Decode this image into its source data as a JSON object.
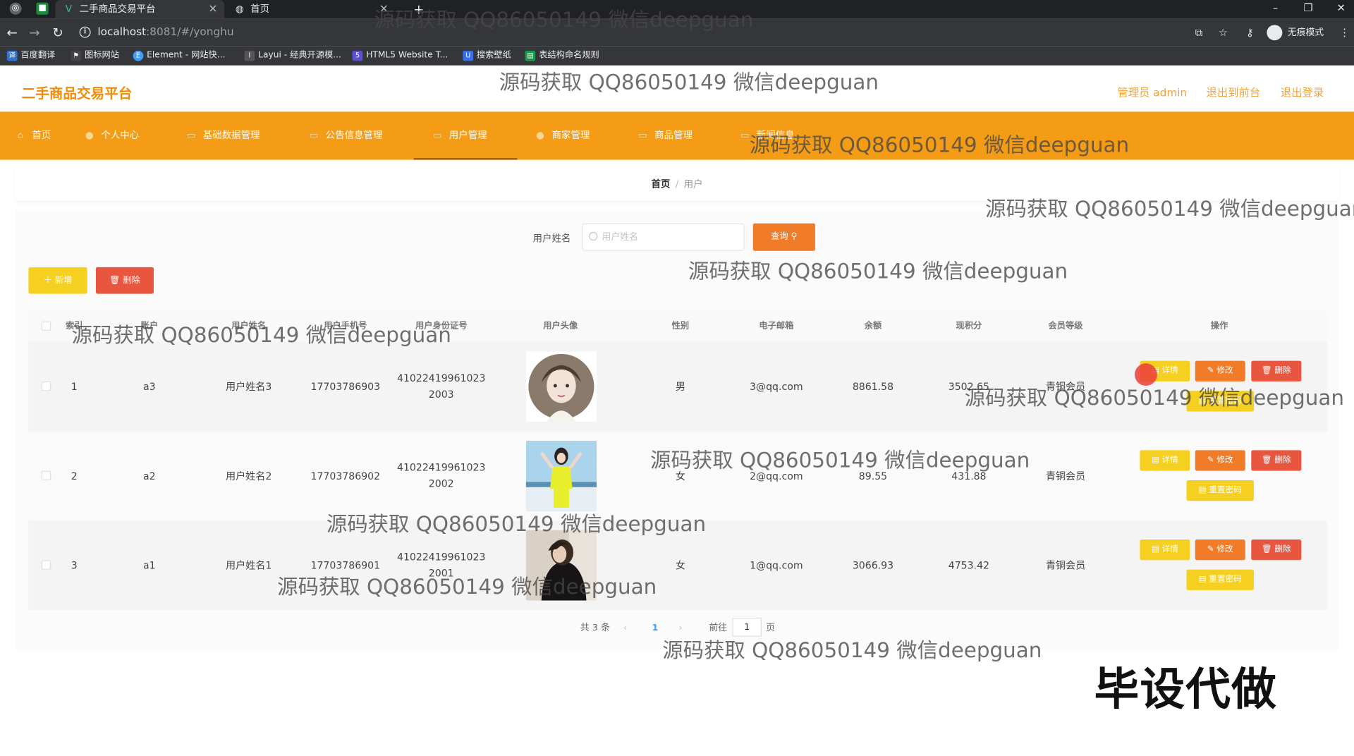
{
  "browser": {
    "tabs": [
      {
        "label": "二手商品交易平台"
      },
      {
        "label": "首页"
      }
    ],
    "url_host": "localhost",
    "url_rest": ":8081/#/yonghu",
    "profile_label": "无痕模式",
    "bookmarks": [
      "百度翻译",
      "图标网站",
      "Element - 网站快...",
      "Layui - 经典开源模...",
      "HTML5 Website T...",
      "搜索壁纸",
      "表结构命名规则"
    ]
  },
  "header": {
    "title": "二手商品交易平台",
    "admin_label": "管理员 admin",
    "frontend_link": "退出到前台",
    "logout_link": "退出登录"
  },
  "nav": {
    "items": [
      {
        "label": "首页"
      },
      {
        "label": "个人中心"
      },
      {
        "label": "基础数据管理"
      },
      {
        "label": "公告信息管理"
      },
      {
        "label": "用户管理"
      },
      {
        "label": "商家管理"
      },
      {
        "label": "商品管理"
      },
      {
        "label": "新闻信息"
      }
    ],
    "active_index": 4
  },
  "breadcrumb": {
    "home": "首页",
    "current": "用户"
  },
  "search": {
    "label": "用户姓名",
    "placeholder": "用户姓名",
    "button": "查询"
  },
  "actions": {
    "add": "＋ 新增",
    "delete": "删除"
  },
  "table": {
    "columns": [
      "索引",
      "账户",
      "用户姓名",
      "用户手机号",
      "用户身份证号",
      "用户头像",
      "性别",
      "电子邮箱",
      "余额",
      "现积分",
      "会员等级",
      "操作"
    ],
    "rows": [
      {
        "index": "1",
        "account": "a3",
        "name": "用户姓名3",
        "phone": "17703786903",
        "id_line1": "41022419961023",
        "id_line2": "2003",
        "gender": "男",
        "email": "3@qq.com",
        "balance": "8861.58",
        "points": "3502.65",
        "level": "青铜会员"
      },
      {
        "index": "2",
        "account": "a2",
        "name": "用户姓名2",
        "phone": "17703786902",
        "id_line1": "41022419961023",
        "id_line2": "2002",
        "gender": "女",
        "email": "2@qq.com",
        "balance": "89.55",
        "points": "431.88",
        "level": "青铜会员"
      },
      {
        "index": "3",
        "account": "a1",
        "name": "用户姓名1",
        "phone": "17703786901",
        "id_line1": "41022419961023",
        "id_line2": "2001",
        "gender": "女",
        "email": "1@qq.com",
        "balance": "3066.93",
        "points": "4753.42",
        "level": "青铜会员"
      }
    ],
    "row_buttons": {
      "detail": "详情",
      "edit": "修改",
      "delete": "删除",
      "reset": "重置密码"
    }
  },
  "pagination": {
    "total": "共 3 条",
    "current": "1",
    "goto_prefix": "前往",
    "goto_value": "1",
    "goto_suffix": "页"
  },
  "overlay": {
    "watermark": "源码获取 QQ86050149 微信deepguan",
    "stamp": "毕设代做"
  }
}
